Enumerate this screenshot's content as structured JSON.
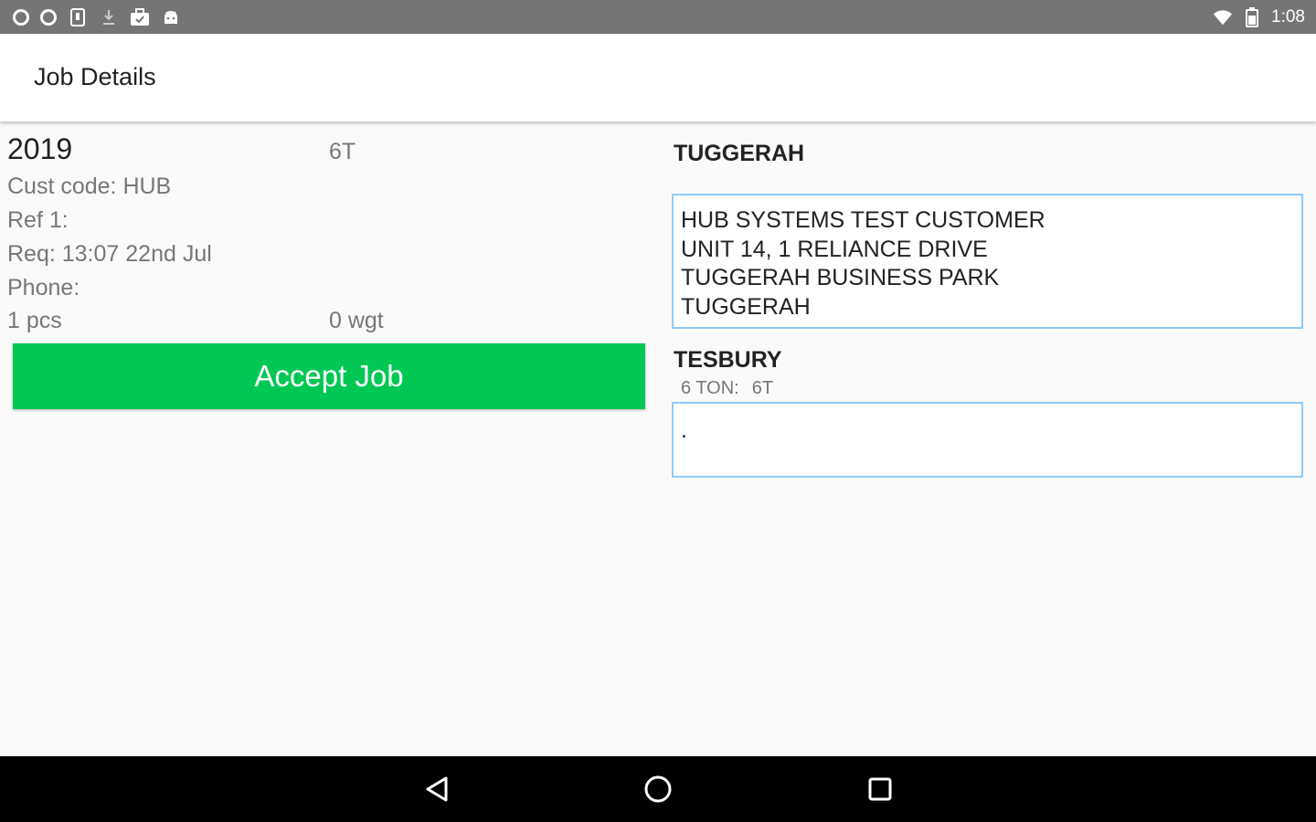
{
  "status_bar": {
    "time": "1:08",
    "left_icons": [
      "circle-icon",
      "circle-icon",
      "sim-card-icon",
      "download-icon",
      "briefcase-icon",
      "android-icon"
    ],
    "right_icons": [
      "wifi-icon",
      "battery-icon"
    ]
  },
  "app_bar": {
    "title": "Job Details"
  },
  "job": {
    "number": "2019",
    "truck": "6T",
    "cust_code": "Cust code: HUB",
    "ref": "Ref 1:",
    "req": "Req: 13:07 22nd Jul",
    "phone": "Phone:",
    "pieces": "1 pcs",
    "weight": "0 wgt",
    "accept_label": "Accept Job"
  },
  "pickup": {
    "title": "TUGGERAH",
    "address_lines": [
      "HUB SYSTEMS TEST CUSTOMER",
      "UNIT 14, 1 RELIANCE DRIVE",
      "TUGGERAH BUSINESS PARK",
      "TUGGERAH"
    ]
  },
  "delivery": {
    "title": "TESBURY",
    "vehicle_type": "6 TON:",
    "vehicle_code": "6T",
    "notes": "."
  },
  "colors": {
    "status_bar": "#757575",
    "accept_button": "#00c853",
    "box_border": "#90caf9",
    "nav_bar": "#000000"
  },
  "nav_bar": {
    "buttons": [
      "back-icon",
      "home-icon",
      "recents-icon"
    ]
  }
}
